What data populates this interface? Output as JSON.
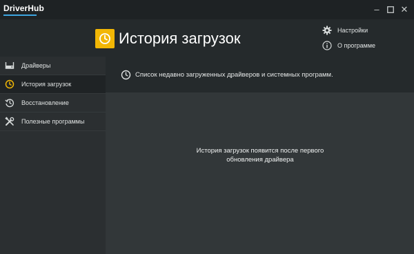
{
  "app": {
    "brand": "DriverHub",
    "window_controls": {
      "minimize": "–",
      "maximize": "☐",
      "close": "✕"
    }
  },
  "header": {
    "title": "История загрузок",
    "links": [
      {
        "label": "Настройки",
        "icon": "gear-icon"
      },
      {
        "label": "О программе",
        "icon": "info-icon"
      }
    ]
  },
  "sidebar": {
    "items": [
      {
        "label": "Драйверы",
        "icon": "drive-icon",
        "active": false
      },
      {
        "label": "История загрузок",
        "icon": "clock-icon",
        "active": true
      },
      {
        "label": "Восстановление",
        "icon": "restore-icon",
        "active": false
      },
      {
        "label": "Полезные программы",
        "icon": "tools-icon",
        "active": false
      }
    ]
  },
  "main": {
    "info": "Список недавно загруженных драйверов и системных программ.",
    "empty_line1": "История загрузок появится после первого",
    "empty_line2": "обновления драйвера"
  },
  "colors": {
    "accent": "#f2b705",
    "brand_underline": "#3ea6e0",
    "titlebar": "#1e2224",
    "panel": "#252a2c",
    "content": "#323739",
    "sidebar": "#2b2f31"
  }
}
